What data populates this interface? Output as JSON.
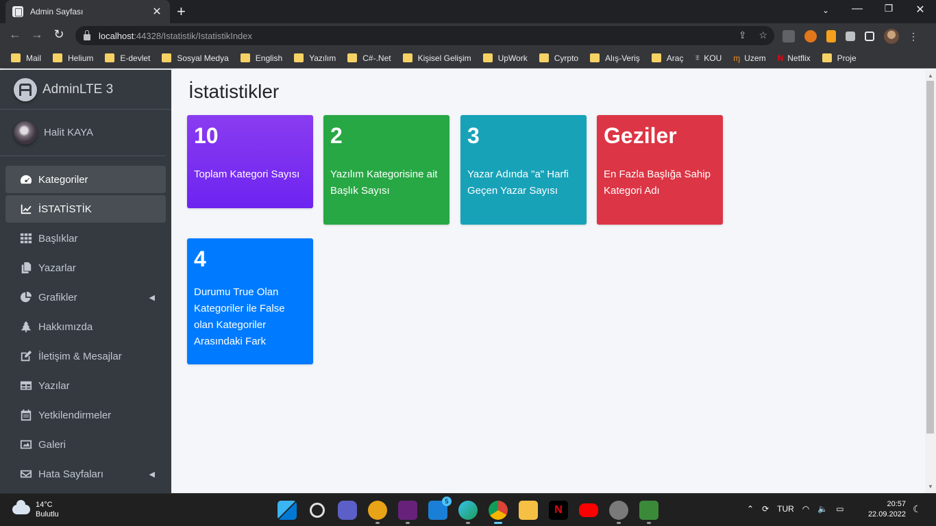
{
  "browser": {
    "tab_title": "Admin Sayfası",
    "tab_close": "✕",
    "new_tab": "+",
    "url_host": "localhost",
    "url_path": ":44328/Istatistik/IstatistikIndex",
    "bookmarks": [
      "Mail",
      "Helium",
      "E-devlet",
      "Sosyal Medya",
      "English",
      "Yazılım",
      "C#-.Net",
      "Kişisel Gelişim",
      "UpWork",
      "Cyrpto",
      "Alış-Veriş",
      "Araç",
      "KOU",
      "Uzem",
      "Netflix",
      "Proje"
    ]
  },
  "sidebar": {
    "brand": "AdminLTE 3",
    "user_name": "Halit KAYA",
    "items": [
      {
        "label": "Kategoriler",
        "icon": "dashboard-icon"
      },
      {
        "label": "İSTATİSTİK",
        "icon": "chart-line-icon"
      },
      {
        "label": "Başlıklar",
        "icon": "grid-icon"
      },
      {
        "label": "Yazarlar",
        "icon": "copy-icon"
      },
      {
        "label": "Grafikler",
        "icon": "pie-chart-icon"
      },
      {
        "label": "Hakkımızda",
        "icon": "tree-icon"
      },
      {
        "label": "İletişim & Mesajlar",
        "icon": "edit-icon"
      },
      {
        "label": "Yazılar",
        "icon": "table-icon"
      },
      {
        "label": "Yetkilendirmeler",
        "icon": "calendar-icon"
      },
      {
        "label": "Galeri",
        "icon": "image-icon"
      },
      {
        "label": "Hata Sayfaları",
        "icon": "envelope-icon"
      }
    ]
  },
  "main": {
    "title": "İstatistikler",
    "boxes": [
      {
        "value": "10",
        "label": "Toplam Kategori Sayısı",
        "color": "#6f42c1"
      },
      {
        "value": "2",
        "label": "Yazılım Kategorisine ait Başlık Sayısı",
        "color": "#28a745"
      },
      {
        "value": "3",
        "label": "Yazar Adında \"a\" Harfi Geçen Yazar Sayısı",
        "color": "#17a2b8"
      },
      {
        "value": "Geziler",
        "label": "En Fazla Başlığa Sahip Kategori Adı",
        "color": "#dc3545"
      },
      {
        "value": "4",
        "label": "Durumu True Olan Kategoriler ile False olan Kategoriler Arasındaki Fark",
        "color": "#007bff"
      }
    ]
  },
  "taskbar": {
    "temperature": "14°C",
    "weather": "Bulutlu",
    "mail_badge": "5",
    "language": "TUR",
    "time": "20:57",
    "date": "22.09.2022"
  }
}
